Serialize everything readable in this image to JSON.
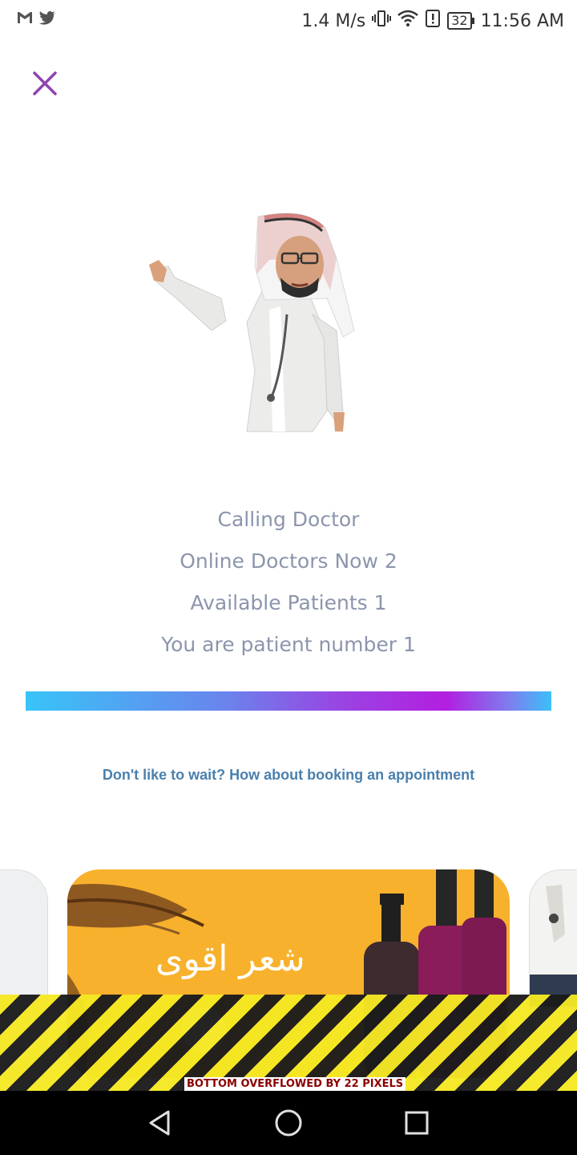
{
  "status_bar": {
    "network_speed": "1.4 M/s",
    "battery": "32",
    "time": "11:56 AM",
    "icons": [
      "gmail-icon",
      "twitter-icon",
      "vibrate-icon",
      "wifi-icon",
      "alert-icon",
      "battery-icon"
    ]
  },
  "call": {
    "status": "Calling Doctor",
    "online_doctors": "Online Doctors Now 2",
    "available_patients": "Available Patients 1",
    "patient_number": "You are patient number 1"
  },
  "appointment_link": "Don't like to wait? How about booking an appointment",
  "promo": {
    "title": "شعر اقوى"
  },
  "overflow_warning": "BOTTOM OVERFLOWED BY 22 PIXELS",
  "colors": {
    "accent": "#8e44ad",
    "text_muted": "#8b95ac",
    "link": "#4a80ad",
    "banner": "#f8b12c"
  }
}
